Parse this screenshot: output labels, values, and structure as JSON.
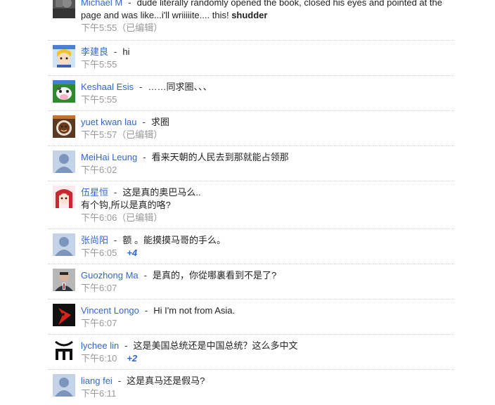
{
  "comments": [
    {
      "author": "Michael M",
      "text": "dude literally randomly opened the book, closed his eyes and pointed at the page and was like...i'll wriiiiite.... this! ",
      "bold": "shudder",
      "time": "下午5:55（已编辑）"
    },
    {
      "author": "李建良",
      "text": "hi",
      "time": "下午5:55"
    },
    {
      "author": "Keshaal Esis",
      "text": "……同求圈、、、",
      "time": "下午5:55"
    },
    {
      "author": "yuet kwan lau",
      "text": "求圈",
      "time": "下午5:57（已编辑）"
    },
    {
      "author": "MeiHai Leung",
      "text": "看来天朝的人民去到那就能占领那",
      "time": "下午6:02"
    },
    {
      "author": "伍星恒",
      "text": "这是真的奥巴马么..",
      "text2": "有个钩,所以是真的咯?",
      "time": "下午6:06（已编辑）"
    },
    {
      "author": "张尚阳",
      "text": "额 。能摸摸马哥的手么。",
      "time": "下午6:05",
      "plus": "+4"
    },
    {
      "author": "Guozhong Ma",
      "text": "是真的，你從哪裏看到不是了?",
      "time": "下午6:07"
    },
    {
      "author": "Vincent Longo",
      "text": "Hi I'm not from Asia.",
      "time": "下午6:07"
    },
    {
      "author": "lychee lin",
      "text": "这是美国总统还是中国总统？这么多中文",
      "time": "下午6:10",
      "plus": "+2"
    },
    {
      "author": "liang fei",
      "text": "这是真马还是假马?",
      "time": "下午6:11"
    }
  ],
  "separator": "-",
  "avatars": [
    "photo-icon",
    "anime-boy-icon",
    "cow-icon",
    "coffee-cup-icon",
    "default-person-icon",
    "anime-girl-icon",
    "default-person-icon",
    "person-photo-icon",
    "red-bird-icon",
    "m-logo-icon",
    "default-person-icon"
  ]
}
